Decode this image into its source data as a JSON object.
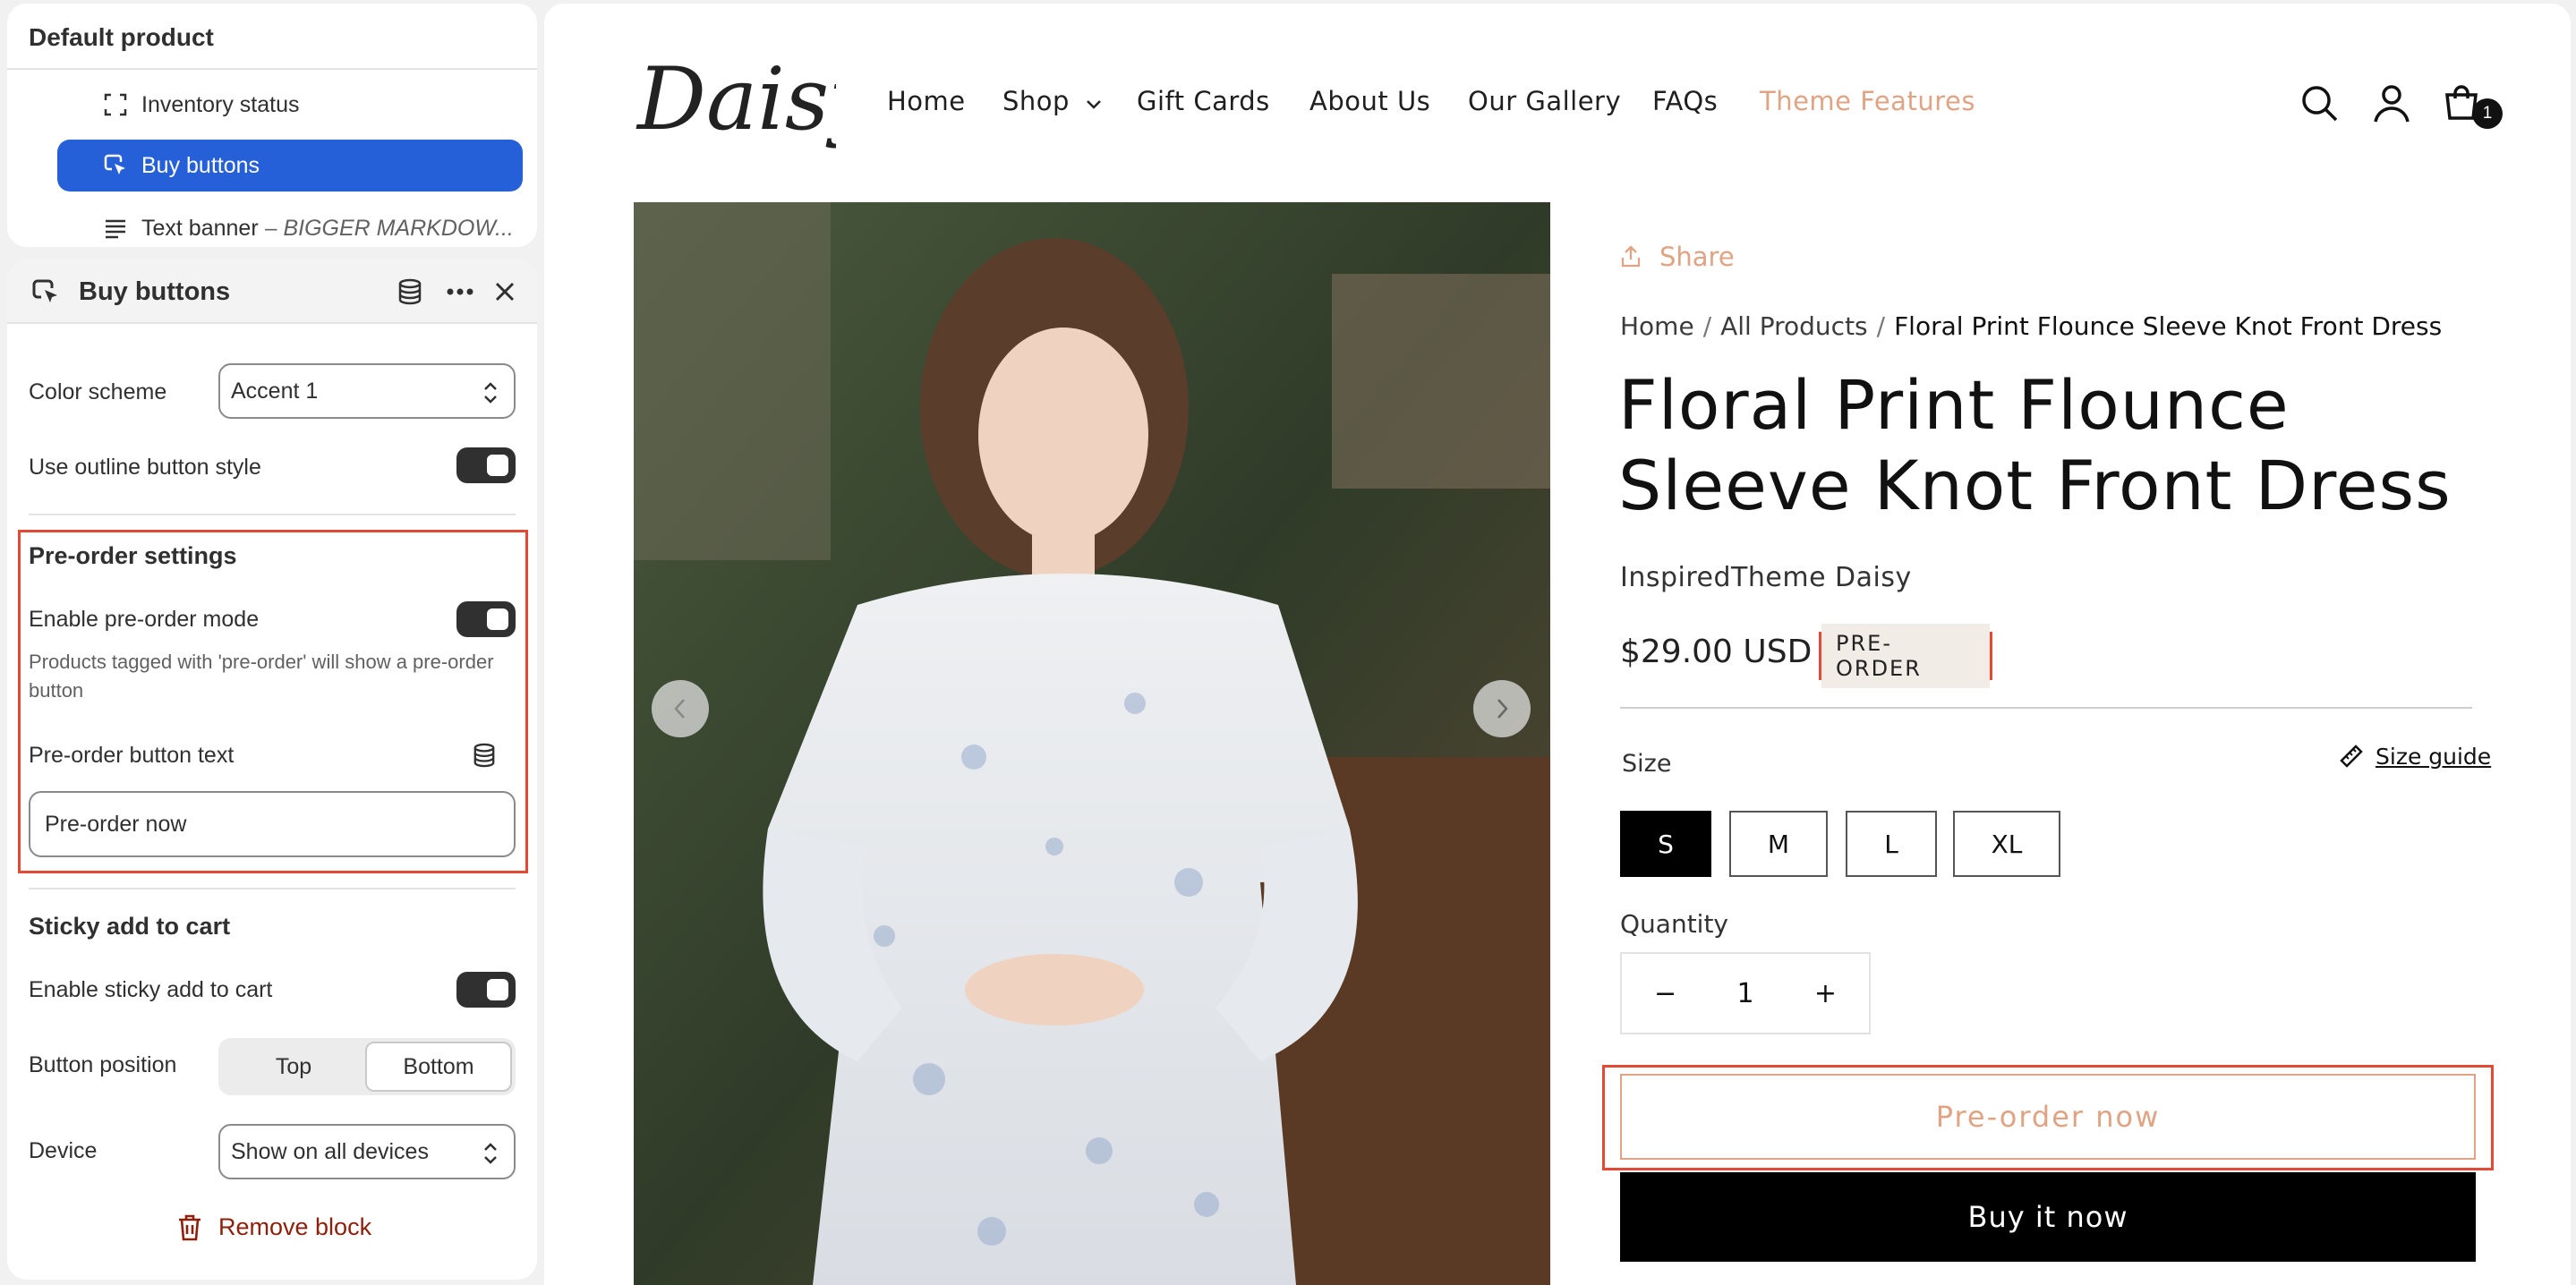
{
  "editor": {
    "section_title": "Default product",
    "tree": [
      {
        "label": "Inventory status",
        "icon": "dashed-square-icon"
      },
      {
        "label": "Buy buttons",
        "icon": "cursor-click-icon"
      },
      {
        "label": "Text banner",
        "suffix": "– BIGGER MARKDOW...",
        "icon": "text-lines-icon"
      }
    ],
    "panel": {
      "title": "Buy buttons",
      "color_scheme_label": "Color scheme",
      "color_scheme_value": "Accent 1",
      "outline_label": "Use outline button style",
      "preorder_title": "Pre-order settings",
      "preorder_enable_label": "Enable pre-order mode",
      "preorder_help": "Products tagged with 'pre-order' will show a pre-order button",
      "preorder_text_label": "Pre-order button text",
      "preorder_text_value": "Pre-order now",
      "sticky_title": "Sticky add to cart",
      "sticky_enable_label": "Enable sticky add to cart",
      "position_label": "Button position",
      "position_options": [
        "Top",
        "Bottom"
      ],
      "position_selected": "Bottom",
      "device_label": "Device",
      "device_value": "Show on all devices",
      "remove_label": "Remove block"
    }
  },
  "store": {
    "logo_text": "Daisy",
    "nav": [
      "Home",
      "Shop",
      "Gift Cards",
      "About Us",
      "Our Gallery",
      "FAQs",
      "Theme Features"
    ],
    "cart_count": "1",
    "share_label": "Share",
    "breadcrumb": [
      "Home",
      "All Products",
      "Floral Print Flounce Sleeve Knot Front Dress"
    ],
    "breadcrumb_sep": "/",
    "product_title": "Floral Print Flounce Sleeve Knot Front Dress",
    "vendor": "InspiredTheme Daisy",
    "price": "$29.00 USD",
    "badge": "PRE-ORDER",
    "size_label": "Size",
    "size_guide": "Size guide",
    "sizes": [
      "S",
      "M",
      "L",
      "XL"
    ],
    "size_selected": "S",
    "quantity_label": "Quantity",
    "quantity_value": "1",
    "qty_minus": "−",
    "qty_plus": "+",
    "preorder_button": "Pre-order now",
    "buy_now": "Buy it now"
  },
  "colors": {
    "accent_blue": "#2560d8",
    "peach": "#e0a484",
    "highlight_red": "#e24a36"
  }
}
